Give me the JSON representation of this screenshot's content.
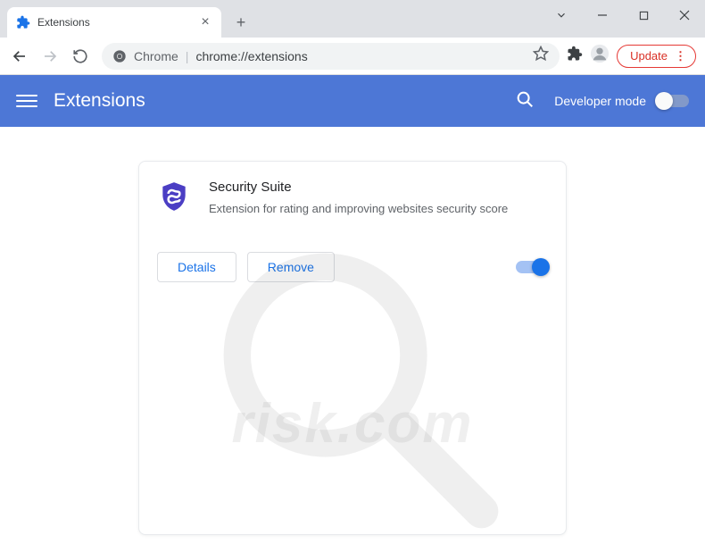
{
  "window": {
    "tab_title": "Extensions"
  },
  "omnibox": {
    "site_label": "Chrome",
    "url": "chrome://extensions"
  },
  "toolbar": {
    "update_label": "Update"
  },
  "ext_header": {
    "title": "Extensions",
    "dev_mode_label": "Developer mode"
  },
  "extension": {
    "name": "Security Suite",
    "description": "Extension for rating and improving websites security score",
    "details_label": "Details",
    "remove_label": "Remove"
  },
  "watermark": {
    "text": "risk.com"
  }
}
